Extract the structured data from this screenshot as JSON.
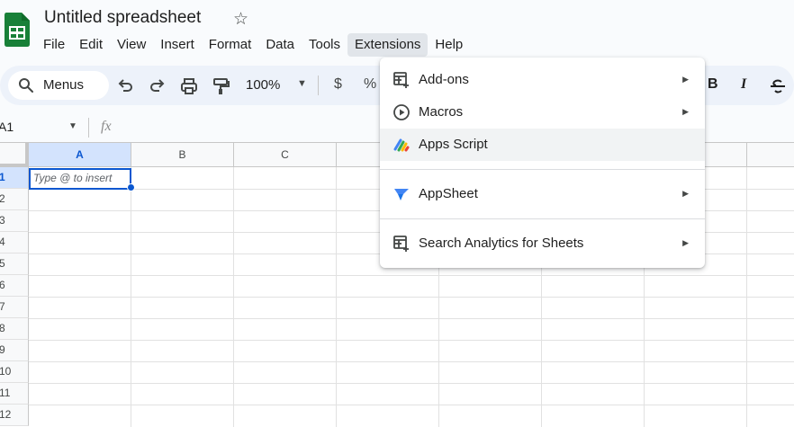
{
  "doc": {
    "title": "Untitled spreadsheet"
  },
  "menubar": [
    "File",
    "Edit",
    "View",
    "Insert",
    "Format",
    "Data",
    "Tools",
    "Extensions",
    "Help"
  ],
  "toolbar": {
    "search_label": "Menus",
    "zoom": "100%",
    "currency": "$",
    "percent": "%"
  },
  "formula_bar": {
    "cell_ref": "A1",
    "fx": "fx"
  },
  "grid": {
    "columns": [
      "A",
      "B",
      "C"
    ],
    "rows": [
      "1",
      "2",
      "3",
      "4",
      "5",
      "6",
      "7",
      "8",
      "9",
      "10",
      "11",
      "12"
    ],
    "active_cell_hint": "Type @ to insert"
  },
  "extensions_menu": {
    "items": [
      {
        "label": "Add-ons",
        "icon": "add-ons-icon",
        "submenu": true
      },
      {
        "label": "Macros",
        "icon": "play-circle-icon",
        "submenu": true
      },
      {
        "label": "Apps Script",
        "icon": "apps-script-icon",
        "submenu": false
      },
      {
        "label": "AppSheet",
        "icon": "appsheet-icon",
        "submenu": true
      },
      {
        "label": "Search Analytics for Sheets",
        "icon": "add-ons-icon",
        "submenu": true
      }
    ]
  },
  "colors": {
    "accent": "#0b57d0",
    "sheets_green": "#188038",
    "toolbar_bg": "#edf2fa",
    "selected_header": "#d3e3fd"
  }
}
